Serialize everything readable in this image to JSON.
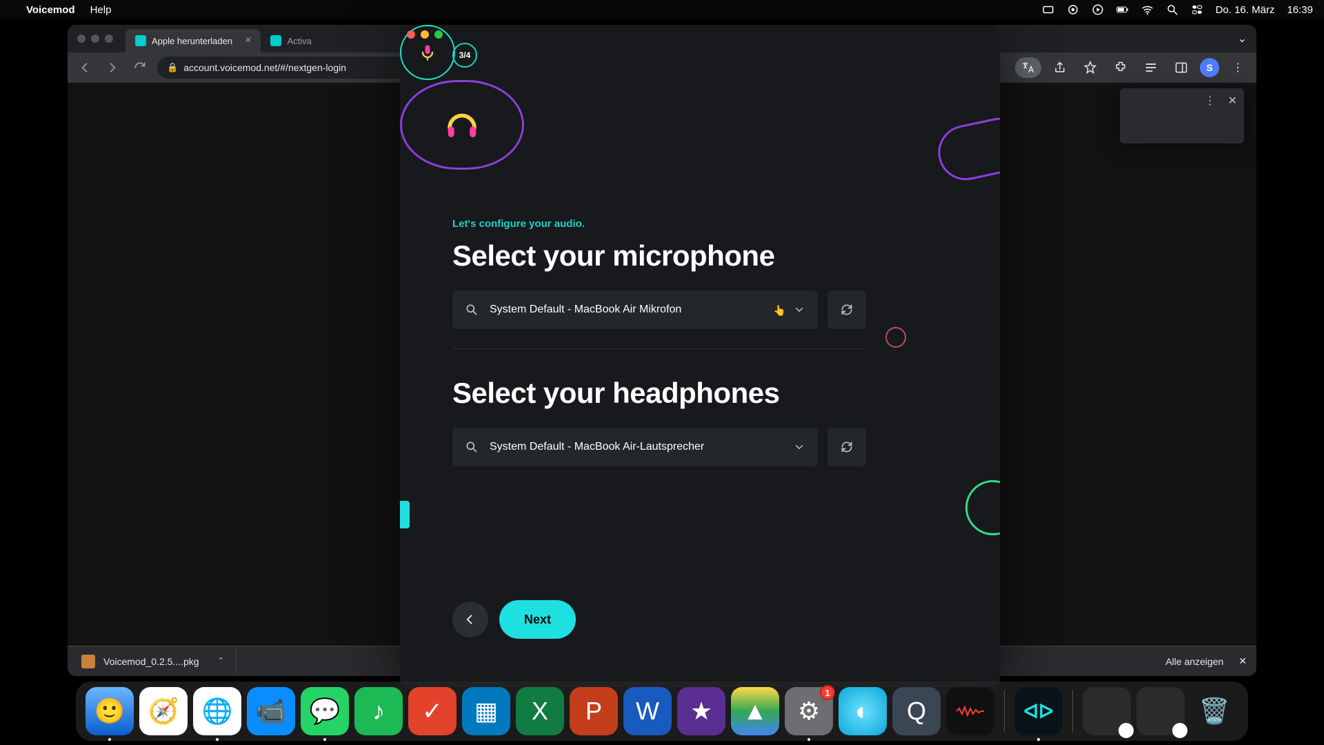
{
  "menubar": {
    "app_name": "Voicemod",
    "help_label": "Help",
    "date": "Do. 16. März",
    "time": "16:39"
  },
  "browser": {
    "tab1_title": "Apple herunterladen",
    "tab2_title": "Activa",
    "url": "account.voicemod.net/#/nextgen-login",
    "avatar_letter": "S",
    "download_filename": "Voicemod_0.2.5....pkg",
    "show_all_label": "Alle anzeigen"
  },
  "app": {
    "step_indicator": "3/4",
    "eyebrow": "Let's configure your audio.",
    "mic_heading": "Select your microphone",
    "mic_value": "System Default - MacBook Air Mikrofon",
    "hp_heading": "Select your headphones",
    "hp_value": "System Default - MacBook Air-Lautsprecher",
    "next_label": "Next"
  },
  "dock": {
    "settings_badge": "1"
  },
  "colors": {
    "accent_teal": "#1fe0e0",
    "accent_mint": "#17d5c5",
    "accent_purple": "#8a3fe0"
  }
}
